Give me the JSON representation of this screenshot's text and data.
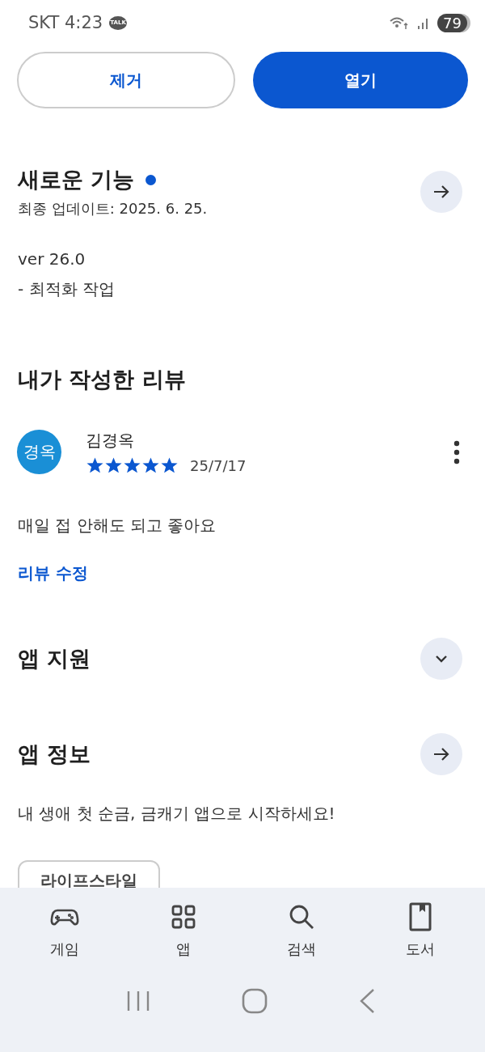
{
  "status_bar": {
    "carrier_time": "SKT 4:23",
    "notification": "TALK",
    "battery": "79"
  },
  "actions": [
    {
      "label": "제거",
      "kind": "outline"
    },
    {
      "label": "열기",
      "kind": "filled"
    }
  ],
  "whats_new": {
    "title": "새로운 기능",
    "new_dot": true,
    "updated": "최종 업데이트: 2025. 6. 25.",
    "lines": [
      "ver 26.0",
      "- 최적화 작업"
    ]
  },
  "my_review": {
    "title": "내가 작성한 리뷰",
    "avatar": "경옥",
    "author": "김경옥",
    "stars": 5,
    "date": "25/7/17",
    "text": "매일 접 안해도 되고 좋아요",
    "edit_link": "리뷰 수정"
  },
  "sections": [
    {
      "title": "앱 지원",
      "kind": "expand"
    },
    {
      "title": "앱 정보",
      "kind": "arrow"
    }
  ],
  "app_info": {
    "description": "내 생애 첫 순금, 금캐기 앱으로 시작하세요!",
    "chip": "라이프스타일"
  },
  "bottom_nav": [
    {
      "label": "게임",
      "kind": "games"
    },
    {
      "label": "앱",
      "kind": "apps"
    },
    {
      "label": "검색",
      "kind": "search"
    },
    {
      "label": "도서",
      "kind": "books"
    }
  ]
}
